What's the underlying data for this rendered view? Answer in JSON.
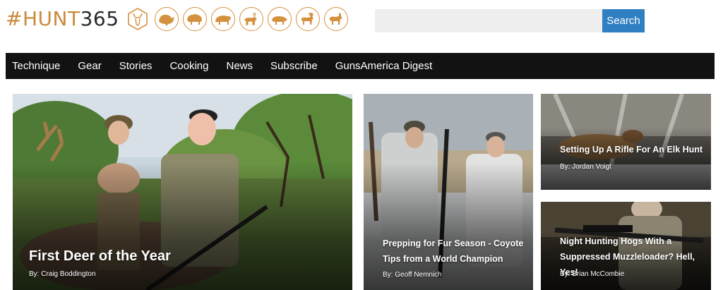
{
  "header": {
    "logo": {
      "hash": "#",
      "hunt": "HUNT",
      "number": "365"
    },
    "animal_badges": [
      "hex-deer-icon",
      "turkey-icon",
      "bison-icon",
      "bear-icon",
      "elk-icon",
      "boar-icon",
      "moose-icon",
      "goat-icon"
    ],
    "search": {
      "placeholder": "",
      "value": "",
      "button_label": "Search"
    }
  },
  "nav": {
    "items": [
      {
        "label": "Technique"
      },
      {
        "label": "Gear"
      },
      {
        "label": "Stories"
      },
      {
        "label": "Cooking"
      },
      {
        "label": "News"
      },
      {
        "label": "Subscribe"
      },
      {
        "label": "GunsAmerica Digest"
      }
    ]
  },
  "articles": {
    "featured": {
      "title": "First Deer of the Year",
      "byline": "By: Craig Boddington"
    },
    "fur": {
      "title": "Prepping for Fur Season - Coyote Tips from a World Champion",
      "byline": "By: Geoff Nemnich"
    },
    "elk": {
      "title": "Setting Up A Rifle For An Elk Hunt",
      "byline": "By: Jordan Voigt"
    },
    "hogs": {
      "title": "Night Hunting Hogs With a Suppressed Muzzleloader? Hell, Yes!",
      "byline": "By: Brian McCombie"
    }
  },
  "colors": {
    "brand_orange": "#d4913f",
    "nav_background": "#121212",
    "search_button": "#2f7fc3",
    "search_field": "#eeeeee"
  }
}
